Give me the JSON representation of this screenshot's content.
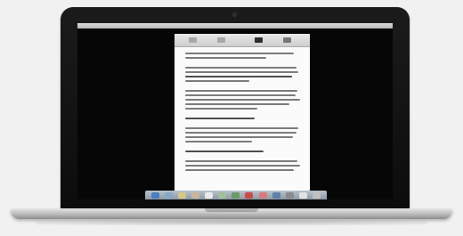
{
  "scene": {
    "subject": "laptop-with-document",
    "document_window": {
      "toolbar_buttons": [
        "btn-1",
        "btn-2",
        "btn-3",
        "btn-4"
      ],
      "paragraphs": [
        [
          0.94,
          0.7
        ],
        [
          0.96,
          0.98,
          0.92,
          0.55
        ],
        [
          0.97,
          0.95,
          0.99,
          0.9,
          0.62
        ],
        [
          0.6
        ],
        [
          0.98,
          0.96,
          0.93,
          0.58
        ],
        [
          0.68
        ],
        [
          0.97,
          0.99,
          0.94
        ]
      ],
      "dark_lines": [
        [
          1,
          2
        ],
        [
          3,
          0
        ],
        [
          5,
          0
        ]
      ]
    },
    "dock_icons": [
      {
        "name": "finder-icon",
        "color": "#4a7fc1"
      },
      {
        "name": "app-icon",
        "color": "#8aa7c8"
      },
      {
        "name": "app-icon",
        "color": "#d7c68a"
      },
      {
        "name": "app-icon",
        "color": "#c7b79b"
      },
      {
        "name": "app-icon",
        "color": "#e9e9e9"
      },
      {
        "name": "app-icon",
        "color": "#9fc09a"
      },
      {
        "name": "app-icon",
        "color": "#6b9a6b"
      },
      {
        "name": "app-icon",
        "color": "#c94a4a"
      },
      {
        "name": "app-icon",
        "color": "#d87a7a"
      },
      {
        "name": "app-icon",
        "color": "#5f7fa8"
      },
      {
        "name": "app-icon",
        "color": "#8a8a8a"
      },
      {
        "name": "app-icon",
        "color": "#e2e2e2"
      },
      {
        "name": "trash-icon",
        "color": "#c0c0c0"
      }
    ]
  }
}
